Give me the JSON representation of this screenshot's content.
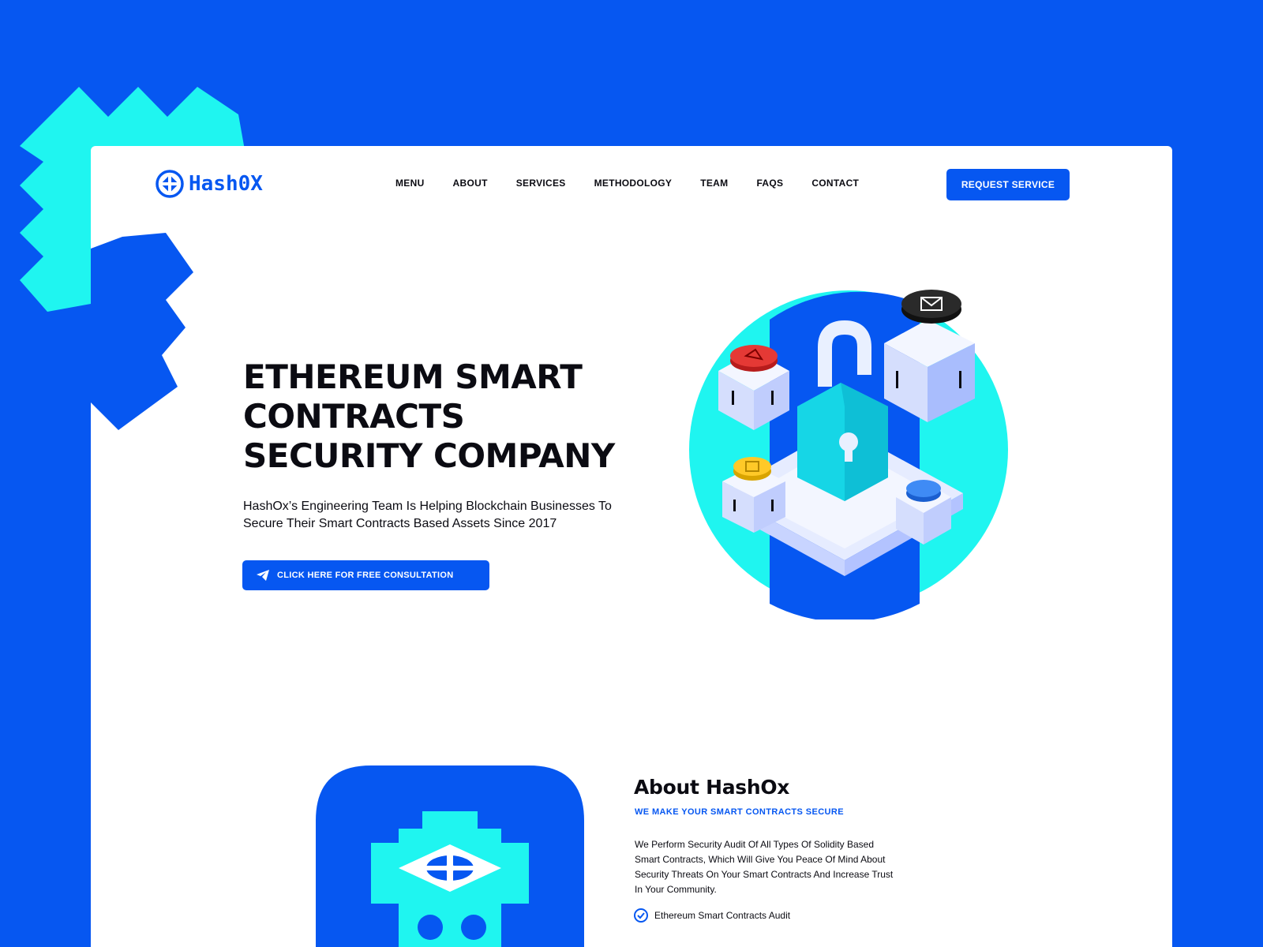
{
  "brand": {
    "name": "Hash0X",
    "accent": "#0657f1",
    "cyan": "#1ff5f0",
    "dark": "#0b0b12"
  },
  "nav": {
    "items": [
      "MENU",
      "ABOUT",
      "SERVICES",
      "METHODOLOGY",
      "TEAM",
      "FAQS",
      "CONTACT"
    ],
    "cta_label": "REQUEST SERVICE"
  },
  "hero": {
    "title_lines": [
      "ETHEREUM SMART",
      "CONTRACTS",
      "SECURITY COMPANY"
    ],
    "subtitle_lines": [
      "HashOx’s Engineering Team Is Helping Blockchain Businesses To",
      "Secure Their Smart Contracts Based Assets Since 2017"
    ],
    "cta_label": "CLICK HERE FOR FREE CONSULTATION",
    "cta_icon": "paper-plane-icon"
  },
  "about": {
    "title": "About HashOx",
    "subtitle": "WE MAKE YOUR SMART CONTRACTS SECURE",
    "text_lines": [
      "We Perform Security Audit Of All Types Of Solidity Based",
      "Smart Contracts, Which Will Give You Peace Of Mind About",
      "Security Threats On Your Smart Contracts And Increase Trust",
      "In Your Community."
    ],
    "features": [
      "Ethereum Smart Contracts Audit"
    ],
    "feature_icon": "check-circle-icon"
  }
}
